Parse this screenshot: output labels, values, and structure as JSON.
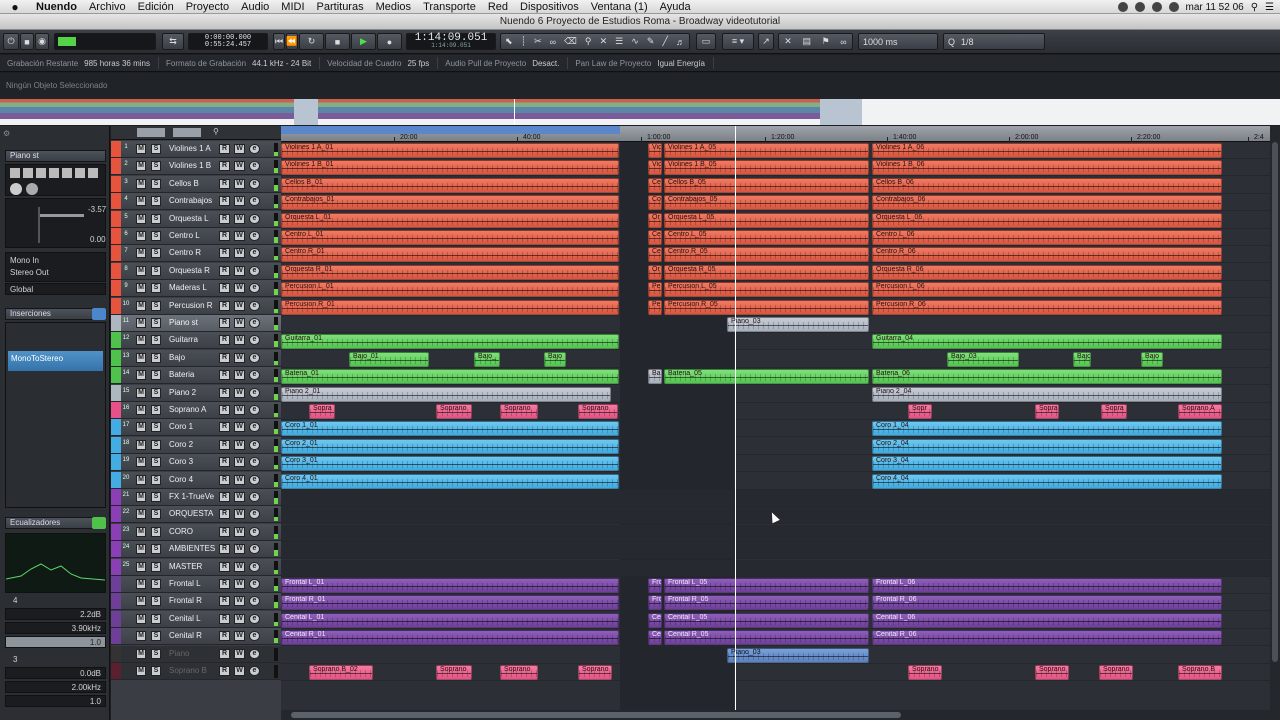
{
  "menubar": {
    "items": [
      "Nuendo",
      "Archivo",
      "Edición",
      "Proyecto",
      "Audio",
      "MIDI",
      "Partituras",
      "Medios",
      "Transporte",
      "Red",
      "Dispositivos",
      "Ventana (1)",
      "Ayuda"
    ],
    "clock": "mar 11 52 06"
  },
  "window": {
    "title": "Nuendo 6 Proyecto de Estudios Roma - Broadway videotutorial"
  },
  "toolbar": {
    "time_top": "0:00:00.000",
    "time_bottom": "0:55:24.457",
    "main_time": "1:14:09.051",
    "main_time_sub": "1:14:09.051",
    "nudge": "1000 ms",
    "quantize": "1/8"
  },
  "infobar": [
    {
      "label": "Grabación Restante",
      "value": "985 horas 36 mins"
    },
    {
      "label": "Formato de Grabación",
      "value": "44.1 kHz - 24 Bit"
    },
    {
      "label": "Velocidad de Cuadro",
      "value": "25 fps"
    },
    {
      "label": "Audio Pull de Proyecto",
      "value": "Desact."
    },
    {
      "label": "Pan Law de Proyecto",
      "value": "Igual Energía"
    }
  ],
  "status": "Ningún Objeto Seleccionado",
  "inspector": {
    "track_name": "Piano st",
    "volume": "-3.57",
    "pan": "0.00",
    "input": "Mono In",
    "output": "Stereo Out",
    "group": "Global",
    "inserts_label": "Inserciones",
    "insert_slot": "MonoToStereo",
    "eq_label": "Ecualizadores",
    "eq_gain": "2.2dB",
    "eq_freq": "3.90kHz",
    "eq_q": "1.0",
    "eq_gain2": "0.0dB",
    "eq_freq2": "2.00kHz",
    "eq_q2": "1.0",
    "eq_band": "4",
    "eq_band2": "3"
  },
  "ruler": {
    "marks": [
      "20:00",
      "40:00",
      "1:00:00",
      "1:20:00",
      "1:40:00",
      "2:00:00",
      "2:20:00",
      "2:4"
    ]
  },
  "tracks": [
    {
      "n": "1",
      "name": "Violines 1 A",
      "color": "#e7543d"
    },
    {
      "n": "2",
      "name": "Violines 1 B",
      "color": "#e7543d"
    },
    {
      "n": "3",
      "name": "Cellos B",
      "color": "#e7543d"
    },
    {
      "n": "4",
      "name": "Contrabajos",
      "color": "#e7543d"
    },
    {
      "n": "5",
      "name": "Orquesta L",
      "color": "#e7543d"
    },
    {
      "n": "6",
      "name": "Centro L",
      "color": "#e7543d"
    },
    {
      "n": "7",
      "name": "Centro R",
      "color": "#e7543d"
    },
    {
      "n": "8",
      "name": "Orquesta R",
      "color": "#e7543d"
    },
    {
      "n": "9",
      "name": "Maderas L",
      "color": "#e7543d"
    },
    {
      "n": "10",
      "name": "Percusion R",
      "color": "#e7543d"
    },
    {
      "n": "11",
      "name": "Piano st",
      "color": "#aeb6c0",
      "sel": true
    },
    {
      "n": "12",
      "name": "Guitarra",
      "color": "#4fc24b"
    },
    {
      "n": "13",
      "name": "Bajo",
      "color": "#4fc24b"
    },
    {
      "n": "14",
      "name": "Bateria",
      "color": "#4fc24b"
    },
    {
      "n": "15",
      "name": "Piano 2",
      "color": "#aeb6c0"
    },
    {
      "n": "16",
      "name": "Soprano A",
      "color": "#e8508a"
    },
    {
      "n": "17",
      "name": "Coro 1",
      "color": "#43ace3"
    },
    {
      "n": "18",
      "name": "Coro 2",
      "color": "#43ace3"
    },
    {
      "n": "19",
      "name": "Coro 3",
      "color": "#43ace3"
    },
    {
      "n": "20",
      "name": "Coro 4",
      "color": "#43ace3"
    },
    {
      "n": "21",
      "name": "FX 1-TrueVe",
      "color": "#8a3fb5"
    },
    {
      "n": "22",
      "name": "ORQUESTA",
      "color": "#8a3fb5"
    },
    {
      "n": "23",
      "name": "CORO",
      "color": "#8a3fb5"
    },
    {
      "n": "24",
      "name": "AMBIENTES",
      "color": "#8a3fb5"
    },
    {
      "n": "25",
      "name": "MASTER",
      "color": "#8a3fb5"
    },
    {
      "n": "",
      "name": "Frontal L",
      "color": "#6d3f99"
    },
    {
      "n": "",
      "name": "Frontal R",
      "color": "#6d3f99"
    },
    {
      "n": "",
      "name": "Cenital L",
      "color": "#6d3f99"
    },
    {
      "n": "",
      "name": "Cenital R",
      "color": "#6d3f99"
    },
    {
      "n": "",
      "name": "Piano",
      "color": "#333",
      "dim": true
    },
    {
      "n": "",
      "name": "Soprano B",
      "color": "#5a2030",
      "dim": true
    }
  ],
  "lanes": [
    [
      [
        "red",
        0,
        338,
        "Violines 1 A_01"
      ],
      [
        "red",
        367,
        14,
        "Vio"
      ],
      [
        "red",
        383,
        205,
        "Violines 1 A_05"
      ],
      [
        "red",
        591,
        350,
        "Violines 1 A_06"
      ]
    ],
    [
      [
        "red",
        0,
        338,
        "Violines 1 B_01"
      ],
      [
        "red",
        367,
        14,
        "Vio"
      ],
      [
        "red",
        383,
        205,
        "Violines 1 B_05"
      ],
      [
        "red",
        591,
        350,
        "Violines 1 B_06"
      ]
    ],
    [
      [
        "red",
        0,
        338,
        "Cellos B_01"
      ],
      [
        "red",
        367,
        14,
        "Ce"
      ],
      [
        "red",
        383,
        205,
        "Cellos B_05"
      ],
      [
        "red",
        591,
        350,
        "Cellos B_06"
      ]
    ],
    [
      [
        "red",
        0,
        338,
        "Contrabajos_01"
      ],
      [
        "red",
        367,
        14,
        "Co"
      ],
      [
        "red",
        383,
        205,
        "Contrabajos_05"
      ],
      [
        "red",
        591,
        350,
        "Contrabajos_06"
      ]
    ],
    [
      [
        "red",
        0,
        338,
        "Orquesta L_01"
      ],
      [
        "red",
        367,
        14,
        "Or"
      ],
      [
        "red",
        383,
        205,
        "Orquesta L_05"
      ],
      [
        "red",
        591,
        350,
        "Orquesta L_06"
      ]
    ],
    [
      [
        "red",
        0,
        338,
        "Centro L_01"
      ],
      [
        "red",
        367,
        14,
        "Ce"
      ],
      [
        "red",
        383,
        205,
        "Centro L_05"
      ],
      [
        "red",
        591,
        350,
        "Centro L_06"
      ]
    ],
    [
      [
        "red",
        0,
        338,
        "Centro R_01"
      ],
      [
        "red",
        367,
        14,
        "Ce"
      ],
      [
        "red",
        383,
        205,
        "Centro R_05"
      ],
      [
        "red",
        591,
        350,
        "Centro R_06"
      ]
    ],
    [
      [
        "red",
        0,
        338,
        "Orquesta R_01"
      ],
      [
        "red",
        367,
        14,
        "Or"
      ],
      [
        "red",
        383,
        205,
        "Orquesta R_05"
      ],
      [
        "red",
        591,
        350,
        "Orquesta R_06"
      ]
    ],
    [
      [
        "red",
        0,
        338,
        "Percusion L_01"
      ],
      [
        "red",
        367,
        14,
        "Pe"
      ],
      [
        "red",
        383,
        205,
        "Percusion L_05"
      ],
      [
        "red",
        591,
        350,
        "Percusion L_06"
      ]
    ],
    [
      [
        "red",
        0,
        338,
        "Percusion R_01"
      ],
      [
        "red",
        367,
        14,
        "Pe"
      ],
      [
        "red",
        383,
        205,
        "Percusion R_05"
      ],
      [
        "red",
        591,
        350,
        "Percusion R_06"
      ]
    ],
    [
      [
        "grey",
        446,
        142,
        "Piano_03"
      ]
    ],
    [
      [
        "green",
        0,
        338,
        "Guitarra_01"
      ],
      [
        "green",
        591,
        350,
        "Guitarra_04"
      ]
    ],
    [
      [
        "green",
        68,
        80,
        "Bajo_01"
      ],
      [
        "green",
        193,
        26,
        "Bajo_"
      ],
      [
        "green",
        263,
        22,
        "Bajo"
      ],
      [
        "green",
        666,
        72,
        "Bajo_03"
      ],
      [
        "green",
        792,
        18,
        "Bajo"
      ],
      [
        "green",
        860,
        22,
        "Bajo"
      ]
    ],
    [
      [
        "green",
        0,
        338,
        "Bateria_01"
      ],
      [
        "grey",
        367,
        14,
        "Ba"
      ],
      [
        "green",
        383,
        205,
        "Bateria_05"
      ],
      [
        "green",
        591,
        350,
        "Bateria_06"
      ]
    ],
    [
      [
        "grey",
        0,
        330,
        "Piano 2_01"
      ],
      [
        "grey",
        591,
        350,
        "Piano 2_04"
      ]
    ],
    [
      [
        "pink",
        28,
        26,
        "Sopra"
      ],
      [
        "pink",
        155,
        36,
        "Soprano"
      ],
      [
        "pink",
        219,
        38,
        "Soprano"
      ],
      [
        "pink",
        297,
        40,
        "Soprano"
      ],
      [
        "pink",
        627,
        24,
        "Sopr"
      ],
      [
        "pink",
        754,
        24,
        "Sopra"
      ],
      [
        "pink",
        820,
        26,
        "Sopra"
      ],
      [
        "pink",
        897,
        44,
        "Soprano A"
      ]
    ],
    [
      [
        "cyan",
        0,
        338,
        "Coro 1_01"
      ],
      [
        "cyan",
        591,
        350,
        "Coro 1_04"
      ]
    ],
    [
      [
        "cyan",
        0,
        338,
        "Coro 2_01"
      ],
      [
        "cyan",
        591,
        350,
        "Coro 2_04"
      ]
    ],
    [
      [
        "cyan",
        0,
        338,
        "Coro 3_01"
      ],
      [
        "cyan",
        591,
        350,
        "Coro 3_04"
      ]
    ],
    [
      [
        "cyan",
        0,
        338,
        "Coro 4_01"
      ],
      [
        "cyan",
        591,
        350,
        "Coro 4_04"
      ]
    ],
    [],
    [],
    [],
    [],
    [],
    [
      [
        "purple",
        0,
        338,
        "Frontal L_01"
      ],
      [
        "purple",
        367,
        14,
        "Fro"
      ],
      [
        "purple",
        383,
        205,
        "Frontal L_05"
      ],
      [
        "purple",
        591,
        350,
        "Frontal L_06"
      ]
    ],
    [
      [
        "purple",
        0,
        338,
        "Frontal R_01"
      ],
      [
        "purple",
        367,
        14,
        "Fro"
      ],
      [
        "purple",
        383,
        205,
        "Frontal R_05"
      ],
      [
        "purple",
        591,
        350,
        "Frontal R_06"
      ]
    ],
    [
      [
        "purple",
        0,
        338,
        "Cenital L_01"
      ],
      [
        "purple",
        367,
        14,
        "Ce"
      ],
      [
        "purple",
        383,
        205,
        "Cenital L_05"
      ],
      [
        "purple",
        591,
        350,
        "Cenital L_06"
      ]
    ],
    [
      [
        "purple",
        0,
        338,
        "Cenital R_01"
      ],
      [
        "purple",
        367,
        14,
        "Ce"
      ],
      [
        "purple",
        383,
        205,
        "Cenital R_05"
      ],
      [
        "purple",
        591,
        350,
        "Cenital R_06"
      ]
    ],
    [
      [
        "blue",
        446,
        142,
        "Piano_03"
      ]
    ],
    [
      [
        "pink",
        28,
        64,
        "Soprano B_02"
      ],
      [
        "pink",
        155,
        36,
        "Soprano"
      ],
      [
        "pink",
        219,
        38,
        "Soprano"
      ],
      [
        "pink",
        297,
        34,
        "Soprano"
      ],
      [
        "pink",
        627,
        34,
        "Soprano"
      ],
      [
        "pink",
        754,
        34,
        "Soprano"
      ],
      [
        "pink",
        818,
        34,
        "Soprano"
      ],
      [
        "pink",
        897,
        44,
        "Soprano B"
      ]
    ]
  ]
}
